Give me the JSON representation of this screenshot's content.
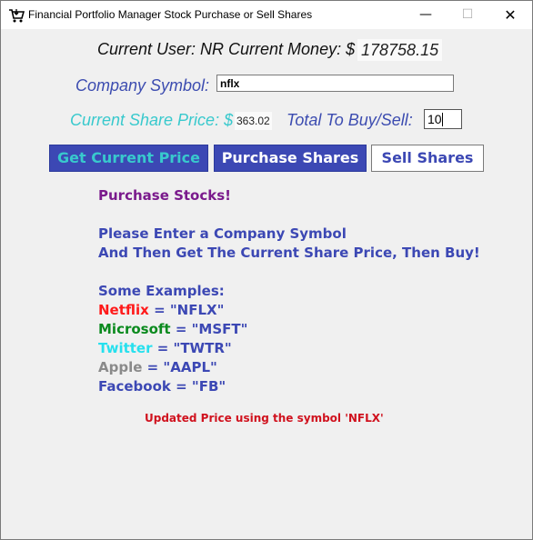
{
  "window": {
    "title": "Financial Portfolio Manager Stock Purchase or Sell Shares",
    "controls": {
      "minimize": "—",
      "maximize": "☐",
      "close": "✕"
    },
    "icon": "shopping-cart-icon"
  },
  "account": {
    "label": "Current User: NR Current Money: $",
    "money": "178758.15"
  },
  "company": {
    "label": "Company Symbol:",
    "symbol_value": "nflx"
  },
  "price": {
    "label": "Current Share Price: $",
    "value": "363.02"
  },
  "total": {
    "label": "Total To Buy/Sell:",
    "value": "10"
  },
  "buttons": {
    "get_price": "Get Current Price",
    "purchase": "Purchase Shares",
    "sell": "Sell Shares"
  },
  "instructions": {
    "heading": "Purchase Stocks!",
    "line1": "Please Enter a Company Symbol",
    "line2": "And Then Get The Current Share Price, Then Buy!",
    "examples_heading": "Some Examples:",
    "examples": [
      {
        "name": "Netflix",
        "code": " = \"NFLX\"",
        "color": "#ff1a1a"
      },
      {
        "name": "Microsoft",
        "code": " = \"MSFT\"",
        "color": "#0b8a1e"
      },
      {
        "name": "Twitter",
        "code": " = \"TWTR\"",
        "color": "#26e0ee"
      },
      {
        "name": "Apple",
        "code": " = \"AAPL\"",
        "color": "#8a8a8a"
      },
      {
        "name": "Facebook",
        "code": " = \"FB\"",
        "color": "#3c48b4"
      }
    ]
  },
  "status": {
    "message": "Updated Price using the symbol 'NFLX'"
  },
  "colors": {
    "accent_blue": "#3c48b4",
    "accent_cyan": "#38c9cd",
    "heading_purple": "#7a1a8c",
    "status_red": "#d0121e"
  }
}
